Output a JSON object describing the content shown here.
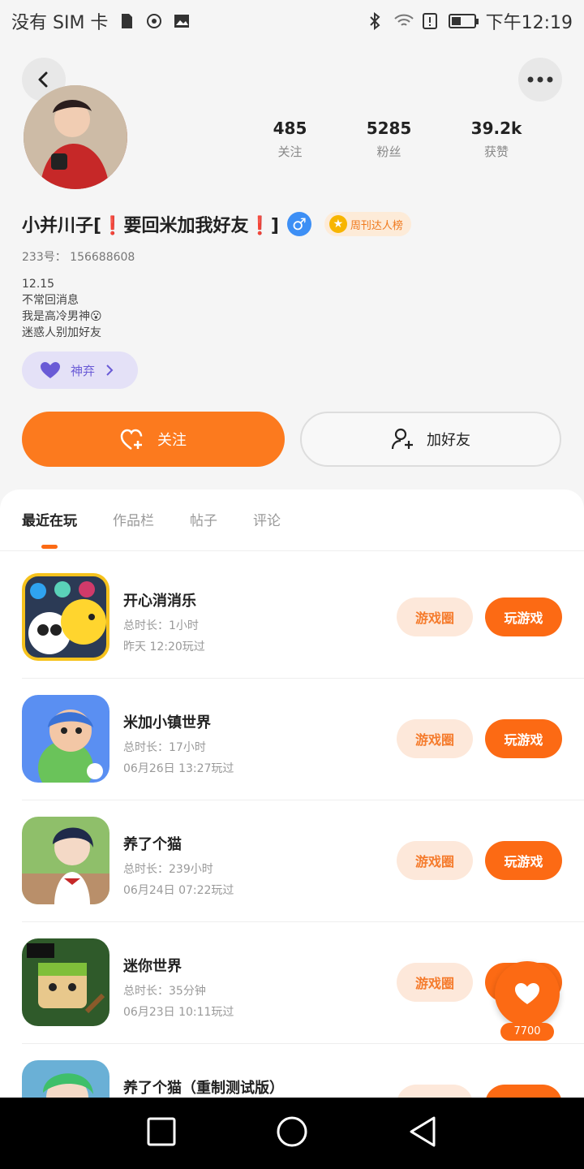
{
  "status_bar": {
    "carrier": "没有 SIM 卡",
    "time": "下午12:19",
    "battery_level_percent": 45
  },
  "profile": {
    "stats": [
      {
        "value": "485",
        "label": "关注"
      },
      {
        "value": "5285",
        "label": "粉丝"
      },
      {
        "value": "39.2k",
        "label": "获赞"
      }
    ],
    "name": "小并川子[❗要回米加我好友❗]",
    "gender_symbol": "♂",
    "badge": "周刊达人榜",
    "uid": "233号： 156688608",
    "bio_lines": [
      "12.15",
      "不常回消息",
      "我是高冷男神😮",
      "迷惑人别加好友"
    ],
    "tag_label": "神弃"
  },
  "actions": {
    "follow_label": "关注",
    "add_friend_label": "加好友"
  },
  "tabs": [
    {
      "label": "最近在玩",
      "active": true
    },
    {
      "label": "作品栏",
      "active": false
    },
    {
      "label": "帖子",
      "active": false
    },
    {
      "label": "评论",
      "active": false
    }
  ],
  "games": [
    {
      "title": "开心消消乐",
      "duration": "总时长：1小时",
      "last_played": "昨天 12:20玩过",
      "circle_label": "游戏圈",
      "play_label": "玩游戏"
    },
    {
      "title": "米加小镇世界",
      "duration": "总时长：17小时",
      "last_played": "06月26日 13:27玩过",
      "circle_label": "游戏圈",
      "play_label": "玩游戏"
    },
    {
      "title": "养了个猫",
      "duration": "总时长：239小时",
      "last_played": "06月24日 07:22玩过",
      "circle_label": "游戏圈",
      "play_label": "玩游戏"
    },
    {
      "title": "迷你世界",
      "duration": "总时长：35分钟",
      "last_played": "06月23日 10:11玩过",
      "circle_label": "游戏圈",
      "play_label": "玩游戏"
    },
    {
      "title": "养了个猫（重制测试版）",
      "duration": "",
      "last_played": "",
      "circle_label": "",
      "play_label": ""
    }
  ],
  "floating_like": {
    "count": "7700"
  },
  "colors": {
    "accent": "#fc6a14",
    "accent_light": "#fde8da",
    "tag_bg": "#e4e1f7",
    "tag_fg": "#6a5bd6"
  }
}
